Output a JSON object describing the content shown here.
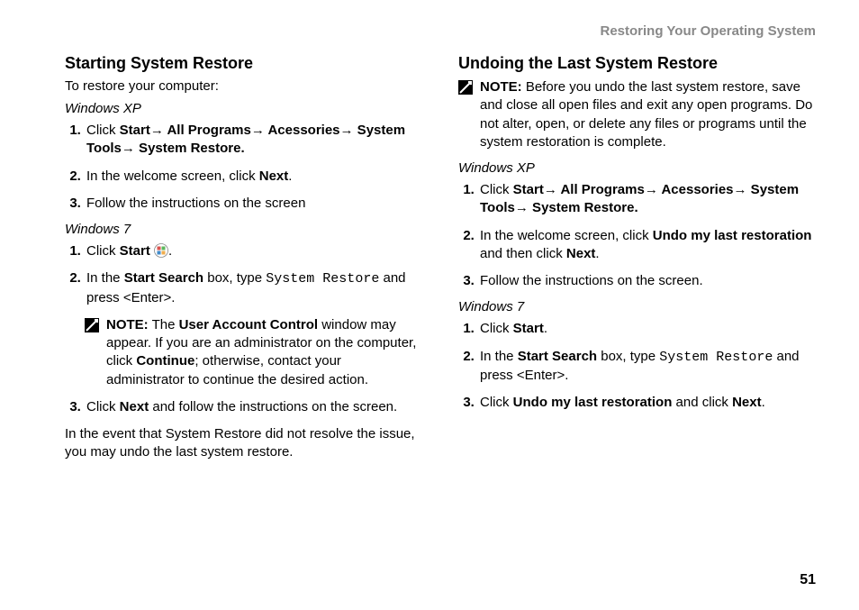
{
  "header": "Restoring Your Operating System",
  "pageNumber": "51",
  "left": {
    "title": "Starting System Restore",
    "intro": "To restore your computer:",
    "xpLabel": "Windows XP",
    "xp": {
      "s1a": "Click ",
      "s1b": "Start",
      "s1c": " All Programs",
      "s1d": " Acessories",
      "s1e": " System Tools",
      "s1f": " System Restore.",
      "s2a": "In the welcome screen, click ",
      "s2b": "Next",
      "s2c": ".",
      "s3": "Follow the instructions on the screen"
    },
    "w7Label": "Windows 7",
    "w7": {
      "s1a": "Click ",
      "s1b": "Start",
      "s1c": " .",
      "s2a": "In the ",
      "s2b": "Start Search",
      "s2c": " box, type ",
      "s2d": "System Restore",
      "s2e": " and press <Enter>.",
      "noteLabel": "NOTE:",
      "noteA": " The ",
      "noteB": "User Account Control",
      "noteC": " window may appear. If you are an administrator on the computer, click ",
      "noteD": "Continue",
      "noteE": "; otherwise, contact your administrator to continue the desired action.",
      "s3a": "Click ",
      "s3b": "Next",
      "s3c": " and follow the instructions on the screen."
    },
    "closing": "In the event that System Restore did not resolve the issue, you may undo the last system restore."
  },
  "right": {
    "title": "Undoing the Last System Restore",
    "noteLabel": "NOTE:",
    "noteText": " Before you undo the last system restore, save and close all open files and exit any open programs. Do not alter, open, or delete any files or programs until the system restoration is complete.",
    "xpLabel": "Windows XP",
    "xp": {
      "s1a": "Click ",
      "s1b": "Start",
      "s1c": " All Programs",
      "s1d": " Acessories",
      "s1e": " System Tools",
      "s1f": " System Restore.",
      "s2a": "In the welcome screen, click ",
      "s2b": "Undo my last restoration",
      "s2c": " and then click ",
      "s2d": "Next",
      "s2e": ".",
      "s3": "Follow the instructions on the screen."
    },
    "w7Label": "Windows 7",
    "w7": {
      "s1a": "Click ",
      "s1b": "Start",
      "s1c": ".",
      "s2a": "In the ",
      "s2b": "Start Search",
      "s2c": " box, type ",
      "s2d": "System Restore",
      "s2e": "  and press <Enter>.",
      "s3a": "Click ",
      "s3b": "Undo my last restoration",
      "s3c": " and click ",
      "s3d": "Next",
      "s3e": "."
    }
  },
  "arrow": "→"
}
